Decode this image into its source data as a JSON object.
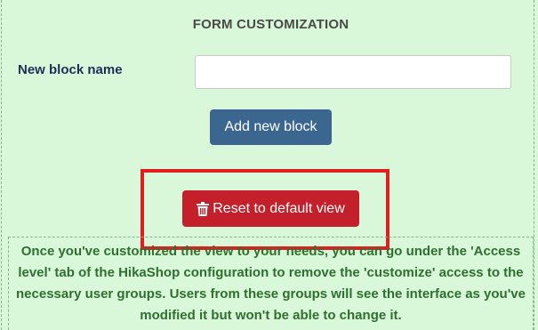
{
  "form": {
    "title": "FORM CUSTOMIZATION",
    "new_block_label": "New block name",
    "new_block_value": "",
    "new_block_placeholder": "",
    "add_button_label": "Add new block",
    "reset_button_label": "Reset to default view",
    "reset_icon": "trash-icon"
  },
  "info": {
    "message": "Once you've customized the view to your needs, you can go under the 'Access level' tab of the HikaShop configuration to remove the 'customize' access to the necessary user groups. Users from these groups will see the interface as you've modified it but won't be able to change it."
  },
  "colors": {
    "background": "#d9f7d9",
    "add_button": "#3b6690",
    "reset_button": "#c4202b",
    "highlight": "#e02020",
    "info_text": "#2f6f2f"
  }
}
